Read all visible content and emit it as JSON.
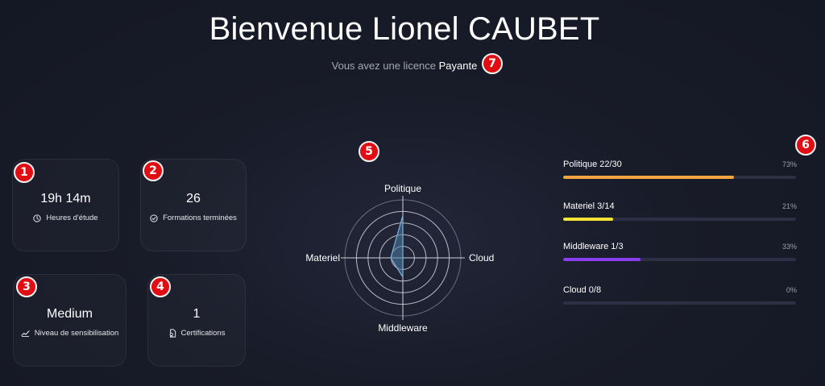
{
  "header": {
    "title": "Bienvenue Lionel CAUBET",
    "license_prefix": "Vous avez une licence",
    "license_type": "Payante"
  },
  "badges": [
    "1",
    "2",
    "3",
    "4",
    "5",
    "6",
    "7"
  ],
  "stats": [
    {
      "value": "19h 14m",
      "label": "Heures d'étude",
      "icon": "clock-icon"
    },
    {
      "value": "26",
      "label": "Formations terminées",
      "icon": "check-circle-icon"
    },
    {
      "value": "Medium",
      "label": "Niveau de sensibilisation",
      "icon": "trend-icon"
    },
    {
      "value": "1",
      "label": "Certifications",
      "icon": "certificate-icon"
    }
  ],
  "radar": {
    "axes": [
      "Politique",
      "Cloud",
      "Middleware",
      "Materiel"
    ],
    "values": [
      0.73,
      0.0,
      0.33,
      0.21
    ],
    "fill_color": "#4d7fa8",
    "stroke_color": "#7fb0d6"
  },
  "progress": [
    {
      "name": "Politique 22/30",
      "percent_label": "73%",
      "fraction": 0.733,
      "color": "#f2a541"
    },
    {
      "name": "Materiel 3/14",
      "percent_label": "21%",
      "fraction": 0.214,
      "color": "#f7e235"
    },
    {
      "name": "Middleware 1/3",
      "percent_label": "33%",
      "fraction": 0.333,
      "color": "#8a3ef0"
    },
    {
      "name": "Cloud 0/8",
      "percent_label": "0%",
      "fraction": 0.0,
      "color": "#2d2f44"
    }
  ]
}
